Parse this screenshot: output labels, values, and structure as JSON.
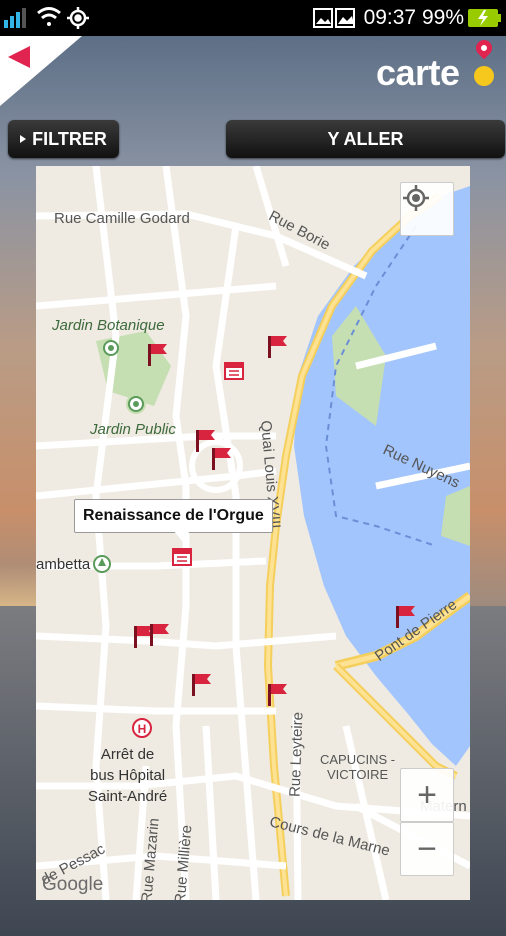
{
  "status_bar": {
    "time": "09:37",
    "battery": "99%"
  },
  "header": {
    "logo": "carte"
  },
  "toolbar": {
    "filter_label": "FILTRER",
    "go_label": "Y ALLER"
  },
  "map": {
    "callout": "Renaissance  de l'Orgue",
    "streets": [
      {
        "id": "camille",
        "label": "Rue Camille Godard"
      },
      {
        "id": "borie",
        "label": "Rue Borie"
      },
      {
        "id": "quai",
        "label": "Quai Louis XVIII"
      },
      {
        "id": "nuyens",
        "label": "Rue Nuyens"
      },
      {
        "id": "pont",
        "label": "Pont de Pierre"
      },
      {
        "id": "leyteire",
        "label": "Rue Leyteire"
      },
      {
        "id": "capucins",
        "label": "CAPUCINS -\nVICTOIRE"
      },
      {
        "id": "marne",
        "label": "Cours de la Marne"
      },
      {
        "id": "mazarin",
        "label": "Rue Mazarin"
      },
      {
        "id": "milliere",
        "label": "Rue Millière"
      },
      {
        "id": "pessac",
        "label": "de Pessac"
      },
      {
        "id": "gambetta",
        "label": "ambetta"
      },
      {
        "id": "materne",
        "label": "Matern"
      }
    ],
    "parks": [
      {
        "id": "botanique",
        "label": "Jardin Botanique"
      },
      {
        "id": "public",
        "label": "Jardin Public"
      }
    ],
    "hospital": "Arrêt de\nbus Hôpital\nSaint-André",
    "attribution": "Google",
    "zoom_in": "+",
    "zoom_out": "−"
  }
}
